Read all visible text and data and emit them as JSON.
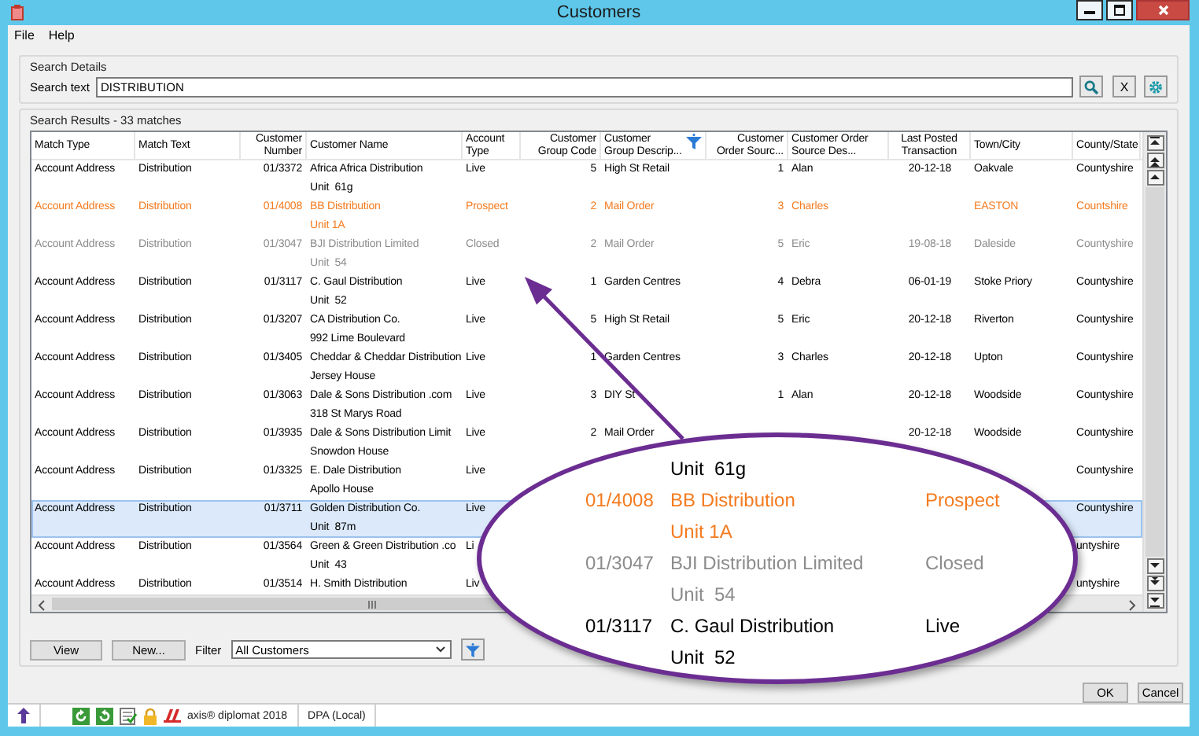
{
  "window": {
    "title": "Customers"
  },
  "menu": [
    "File",
    "Help"
  ],
  "search_details": {
    "title": "Search Details",
    "label": "Search text",
    "value": "DISTRIBUTION",
    "clear_button": "X"
  },
  "search_results": {
    "title": "Search Results - 33 matches"
  },
  "table": {
    "columns": [
      {
        "label": "Match Type",
        "filtered": false
      },
      {
        "label": "Match Text",
        "filtered": false
      },
      {
        "label": "Customer Number",
        "filtered": false
      },
      {
        "label": "Customer Name",
        "filtered": false
      },
      {
        "label": "Account Type",
        "filtered": false
      },
      {
        "label": "Customer Group Code",
        "filtered": false
      },
      {
        "label": "Customer Group Descrip...",
        "filtered": true
      },
      {
        "label": "Customer Order Sourc...",
        "filtered": false
      },
      {
        "label": "Customer Order Source Des...",
        "filtered": false
      },
      {
        "label": "Last Posted Transaction",
        "filtered": false
      },
      {
        "label": "Town/City",
        "filtered": false
      },
      {
        "label": "County/State",
        "filtered": false
      }
    ],
    "rows": [
      {
        "selected": false,
        "color": "#000000",
        "match_type": "Account Address",
        "match_text": "Distribution",
        "customer_number": "01/3372",
        "customer_name": "Africa Africa Distribution",
        "address": "Unit  61g",
        "account_type": "Live",
        "group_code": "5",
        "group_description": "High St Retail",
        "order_source": "1",
        "order_source_description": "Alan",
        "last_posted": "20-12-18",
        "town": "Oakvale",
        "county": "Countyshire"
      },
      {
        "selected": false,
        "color": "#f47b20",
        "match_type": "Account Address",
        "match_text": "Distribution",
        "customer_number": "01/4008",
        "customer_name": "BB Distribution",
        "address": "Unit 1A",
        "account_type": "Prospect",
        "group_code": "2",
        "group_description": "Mail Order",
        "order_source": "3",
        "order_source_description": "Charles",
        "town": "EASTON",
        "county": "Countshire"
      },
      {
        "selected": false,
        "color": "#8c8c8c",
        "match_type": "Account Address",
        "match_text": "Distribution",
        "customer_number": "01/3047",
        "customer_name": "BJI Distribution Limited",
        "address": "Unit  54",
        "account_type": "Closed",
        "group_code": "2",
        "group_description": "Mail Order",
        "order_source": "5",
        "order_source_description": "Eric",
        "last_posted": "19-08-18",
        "town": "Daleside",
        "county": "Countyshire"
      },
      {
        "selected": false,
        "color": "#000000",
        "match_type": "Account Address",
        "match_text": "Distribution",
        "customer_number": "01/3117",
        "customer_name": "C. Gaul Distribution",
        "address": "Unit  52",
        "account_type": "Live",
        "group_code": "1",
        "group_description": "Garden Centres",
        "order_source": "4",
        "order_source_description": "Debra",
        "last_posted": "06-01-19",
        "town": "Stoke Priory",
        "county": "Countyshire"
      },
      {
        "selected": false,
        "color": "#000000",
        "match_type": "Account Address",
        "match_text": "Distribution",
        "customer_number": "01/3207",
        "customer_name": "CA Distribution Co.",
        "address": "992 Lime Boulevard",
        "account_type": "Live",
        "group_code": "5",
        "group_description": "High St Retail",
        "order_source": "5",
        "order_source_description": "Eric",
        "last_posted": "20-12-18",
        "town": "Riverton",
        "county": "Countyshire"
      },
      {
        "selected": false,
        "color": "#000000",
        "match_type": "Account Address",
        "match_text": "Distribution",
        "customer_number": "01/3405",
        "customer_name": "Cheddar & Cheddar Distribution",
        "address": "Jersey House",
        "account_type": "Live",
        "group_code": "1",
        "group_description": "Garden Centres",
        "order_source": "3",
        "order_source_description": "Charles",
        "last_posted": "20-12-18",
        "town": "Upton",
        "county": "Countyshire"
      },
      {
        "selected": false,
        "color": "#000000",
        "match_type": "Account Address",
        "match_text": "Distribution",
        "customer_number": "01/3063",
        "customer_name": "Dale & Sons Distribution .com",
        "address": "318 St Marys Road",
        "account_type": "Live",
        "group_code": "3",
        "group_description": "DIY St",
        "order_source": "1",
        "order_source_description": "Alan",
        "last_posted": "20-12-18",
        "town": "Woodside",
        "county": "Countyshire"
      },
      {
        "selected": false,
        "color": "#000000",
        "match_type": "Account Address",
        "match_text": "Distribution",
        "customer_number": "01/3935",
        "customer_name": "Dale & Sons Distribution Limit",
        "address": "Snowdon House",
        "account_type": "Live",
        "group_code": "2",
        "group_description": "Mail Order",
        "last_posted": "20-12-18",
        "town": "Woodside",
        "county": "Countyshire"
      },
      {
        "selected": false,
        "color": "#000000",
        "match_type": "Account Address",
        "match_text": "Distribution",
        "customer_number": "01/3325",
        "customer_name": "E. Dale Distribution",
        "address": "Apollo House",
        "account_type": "Live",
        "county": "Countyshire"
      },
      {
        "selected": true,
        "color": "#000000",
        "match_type": "Account Address",
        "match_text": "Distribution",
        "customer_number": "01/3711",
        "customer_name": "Golden Distribution Co.",
        "address": "Unit  87m",
        "account_type": "Live",
        "county": "Countyshire"
      },
      {
        "selected": false,
        "color": "#000000",
        "match_type": "Account Address",
        "match_text": "Distribution",
        "customer_number": "01/3564",
        "customer_name": "Green & Green Distribution .co",
        "address": "Unit  43",
        "account_type": "Li",
        "county": "untyshire"
      },
      {
        "selected": false,
        "color": "#000000",
        "match_type": "Account Address",
        "match_text": "Distribution",
        "customer_number": "01/3514",
        "customer_name": "H. Smith Distribution",
        "account_type": "Liv",
        "county": "untyshire"
      }
    ]
  },
  "actions": {
    "view_button": "View",
    "new_button": "New...",
    "filter_label": "Filter",
    "filter_value": "All Customers"
  },
  "dialog_buttons": [
    "OK",
    "Cancel"
  ],
  "status_bar": {
    "items": [
      "axis® diplomat 2018",
      "DPA (Local)"
    ]
  },
  "callout": {
    "lines": [
      {
        "color": "#000000",
        "name": "Unit  61g"
      },
      {
        "color": "#f47b20",
        "number": "01/4008",
        "name": "BB Distribution",
        "account_type": "Prospect"
      },
      {
        "color": "#f47b20",
        "name": "Unit 1A"
      },
      {
        "color": "#8c8c8c",
        "number": "01/3047",
        "name": "BJI Distribution Limited",
        "account_type": "Closed"
      },
      {
        "color": "#8c8c8c",
        "name": "Unit  54"
      },
      {
        "color": "#000000",
        "number": "01/3117",
        "name": "C. Gaul Distribution",
        "account_type": "Live"
      },
      {
        "color": "#000000",
        "name": "Unit  52"
      }
    ]
  }
}
